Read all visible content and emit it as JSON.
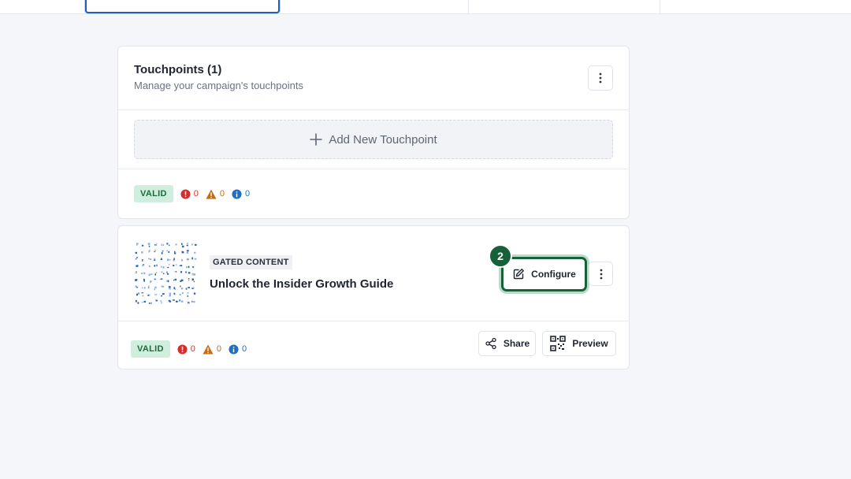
{
  "touchpoints_card": {
    "title": "Touchpoints (1)",
    "subtitle": "Manage your campaign's touchpoints",
    "add_label": "Add New Touchpoint",
    "status": {
      "badge": "VALID",
      "errors": "0",
      "warnings": "0",
      "infos": "0"
    }
  },
  "touchpoint": {
    "tag": "GATED CONTENT",
    "title": "Unlock the Insider Growth Guide",
    "step_number": "2",
    "configure_label": "Configure",
    "share_label": "Share",
    "preview_label": "Preview",
    "status": {
      "badge": "VALID",
      "errors": "0",
      "warnings": "0",
      "infos": "0"
    }
  },
  "colors": {
    "accent_green": "#17613a",
    "valid_bg": "#cfeedd",
    "error": "#d12f2f",
    "warning": "#c76a12",
    "info": "#1f6fc4"
  }
}
